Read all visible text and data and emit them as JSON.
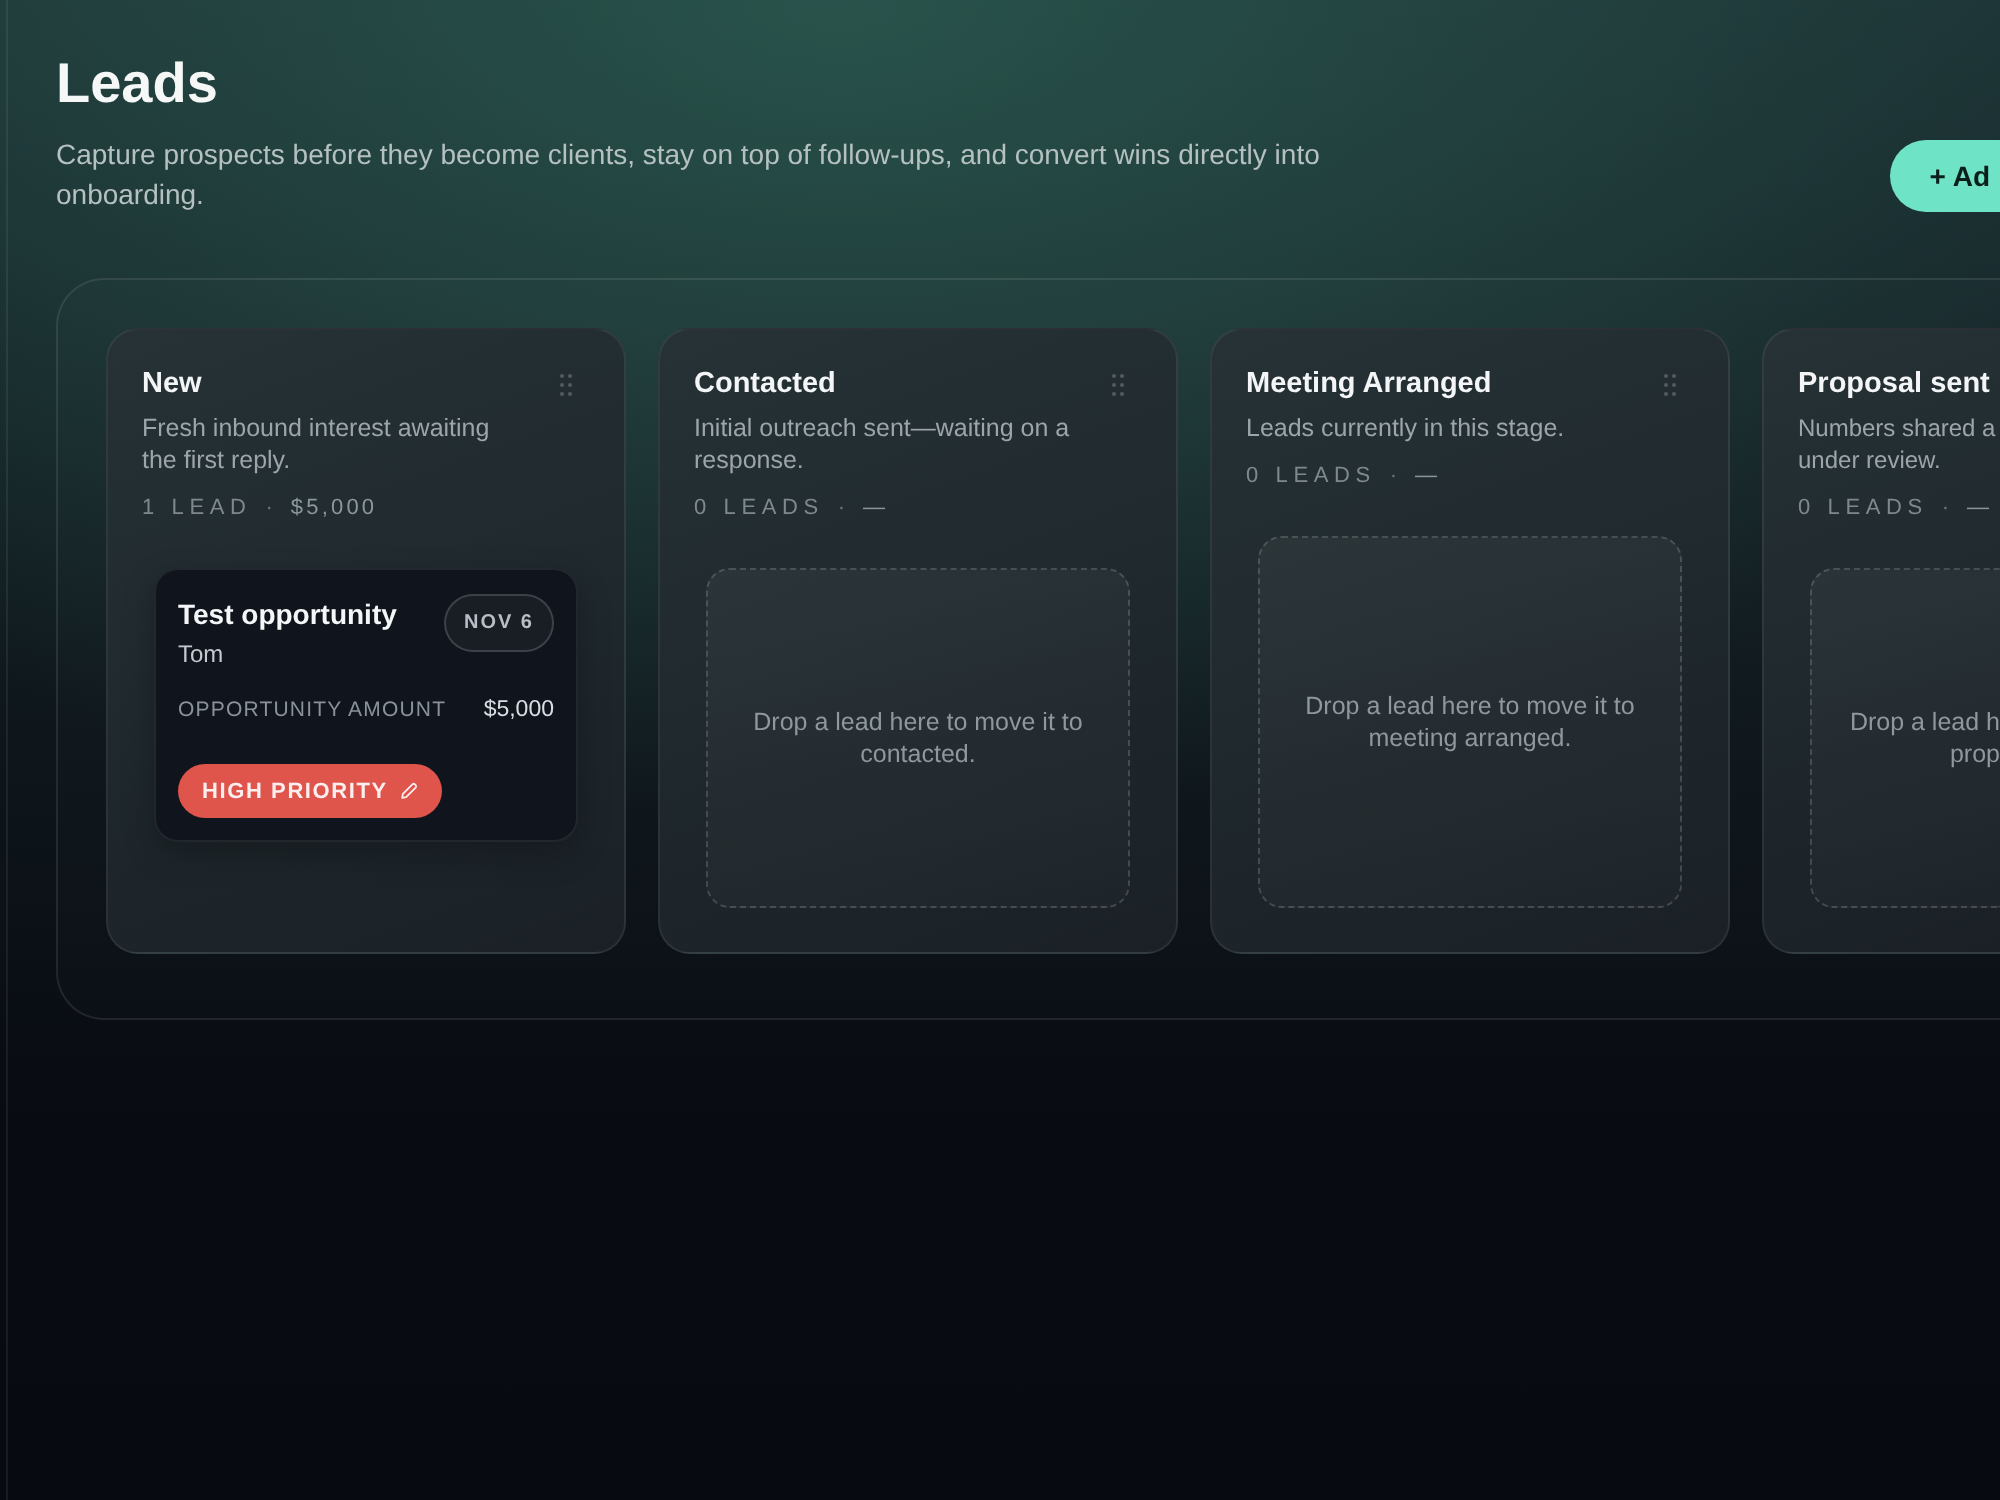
{
  "page": {
    "title": "Leads",
    "description": "Capture prospects before they become clients, stay on top of follow-ups, and convert wins directly into onboarding.",
    "add_button": "+ Ad"
  },
  "columns": [
    {
      "title": "New",
      "description": "Fresh inbound interest awaiting the first reply.",
      "lead_count": "1 LEAD",
      "separator": "·",
      "total": "$5,000",
      "leads": [
        {
          "title": "Test opportunity",
          "contact": "Tom",
          "date": "NOV 6",
          "amount_label": "OPPORTUNITY AMOUNT",
          "amount": "$5,000",
          "priority": {
            "kind": "high",
            "label": "HIGH PRIORITY"
          }
        }
      ]
    },
    {
      "title": "Contacted",
      "description": "Initial outreach sent—waiting on a response.",
      "lead_count": "0 LEADS",
      "separator": "·",
      "total": "—",
      "drop_hint": "Drop a lead here to move it to contacted."
    },
    {
      "title": "Meeting Arranged",
      "description": "Leads currently in this stage.",
      "lead_count": "0 LEADS",
      "separator": "·",
      "total": "—",
      "drop_hint": "Drop a lead here to move it to meeting arranged."
    },
    {
      "title": "Proposal sent",
      "description": "Numbers shared a\nunder review.",
      "lead_count": "0 LEADS",
      "separator": "·",
      "total": "—",
      "drop_hint": "Drop a lead h\nprop"
    }
  ]
}
